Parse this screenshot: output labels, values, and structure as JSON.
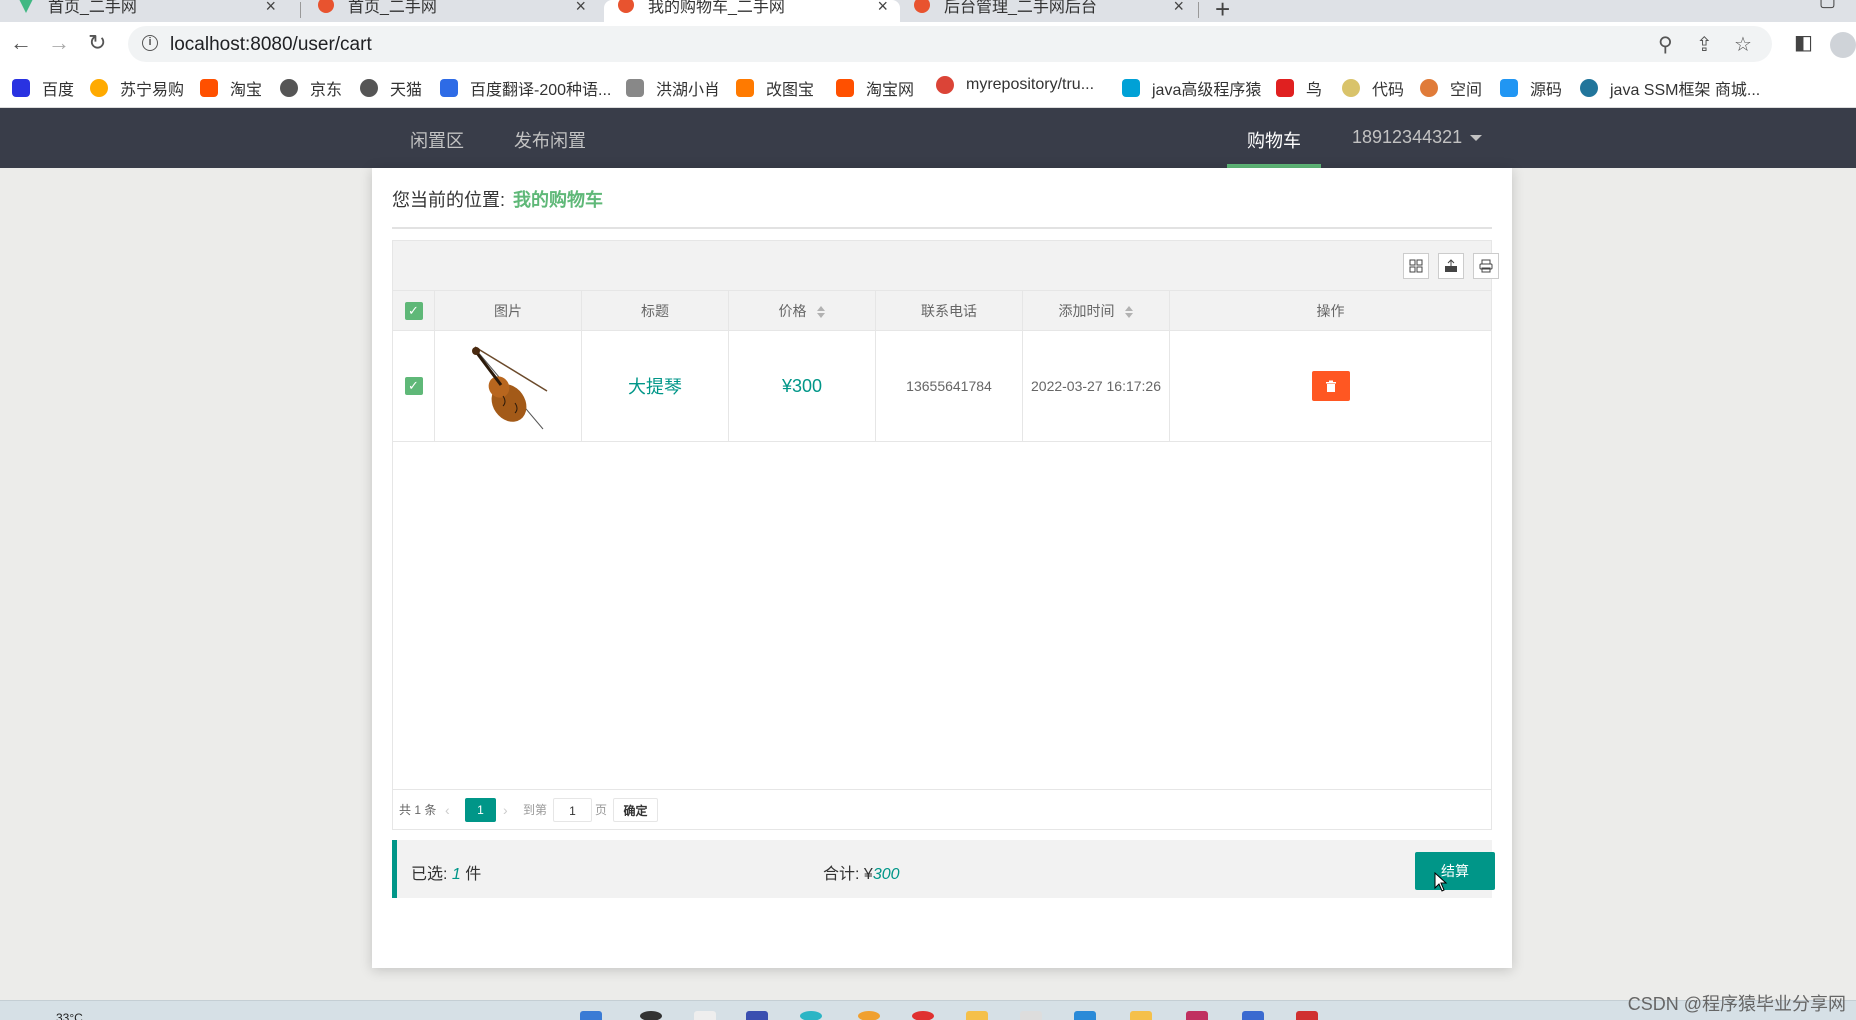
{
  "browser": {
    "tabs": [
      {
        "title": "首页_二手网",
        "icon_color": "#41b883"
      },
      {
        "title": "首页_二手网",
        "icon_color": "#e8532f"
      },
      {
        "title": "我的购物车_二手网",
        "icon_color": "#e8532f"
      },
      {
        "title": "后台管理_二手网后台",
        "icon_color": "#e8532f"
      }
    ],
    "new_tab_label": "+",
    "url": "localhost:8080/user/cart",
    "bookmarks": [
      {
        "label": "百度",
        "icon_color": "#2932e1"
      },
      {
        "label": "苏宁易购",
        "icon_color": "#ffaa00"
      },
      {
        "label": "淘宝",
        "icon_color": "#ff5000"
      },
      {
        "label": "京东",
        "icon_color": "#555555"
      },
      {
        "label": "天猫",
        "icon_color": "#555555"
      },
      {
        "label": "百度翻译-200种语...",
        "icon_color": "#2e6be6"
      },
      {
        "label": "洪湖小肖",
        "icon_color": "#888888"
      },
      {
        "label": "改图宝",
        "icon_color": "#ff7a00"
      },
      {
        "label": "淘宝网",
        "icon_color": "#ff5000"
      },
      {
        "label": "myrepository/tru...",
        "icon_color": "#db4437"
      },
      {
        "label": "java高级程序猿",
        "icon_color": "#00a1d6"
      },
      {
        "label": "鸟",
        "icon_color": "#e02020"
      },
      {
        "label": "代码",
        "icon_color": "#d9c36a"
      },
      {
        "label": "空间",
        "icon_color": "#e07b39"
      },
      {
        "label": "源码",
        "icon_color": "#2196f3"
      },
      {
        "label": "java SSM框架 商城...",
        "icon_color": "#21759b"
      }
    ]
  },
  "site_nav": {
    "left_items": [
      "闲置区",
      "发布闲置"
    ],
    "cart_label": "购物车",
    "user_label": "18912344321",
    "bg_color": "#393d49",
    "accent": "#5fb878"
  },
  "breadcrumb": {
    "prefix": "您当前的位置:",
    "location": "我的购物车"
  },
  "table": {
    "tools": [
      "columns-icon",
      "export-icon",
      "print-icon"
    ],
    "headers": {
      "image": "图片",
      "title": "标题",
      "price": "价格",
      "phone": "联系电话",
      "added": "添加时间",
      "action": "操作"
    },
    "rows": [
      {
        "checked": true,
        "image": "violin",
        "title": "大提琴",
        "price": "¥300",
        "phone": "13655641784",
        "added": "2022-03-27 16:17:26"
      }
    ]
  },
  "pager": {
    "total": "共 1 条",
    "current": "1",
    "goto_prefix": "到第",
    "goto_value": "1",
    "goto_suffix": "页",
    "confirm": "确定"
  },
  "summary": {
    "selected_label": "已选:",
    "selected_count": "1",
    "selected_unit": "件",
    "total_label": "合计:",
    "currency": "¥",
    "total_value": "300",
    "checkout": "结算",
    "accent": "#009688"
  },
  "taskbar": {
    "temperature": "33°C"
  },
  "watermark": "CSDN @程序猿毕业分享网"
}
